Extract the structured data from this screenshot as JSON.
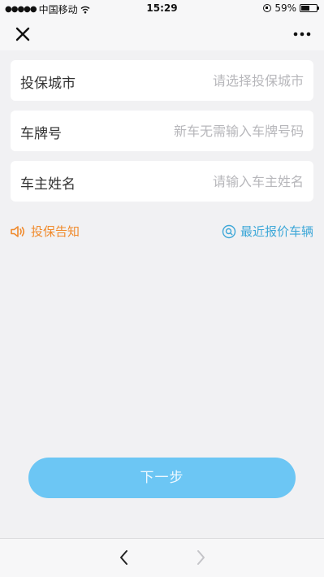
{
  "status_bar": {
    "signal": "●●●●●",
    "carrier": "中国移动",
    "time": "15:29",
    "battery": "59%",
    "battery_level": 0.59
  },
  "form": {
    "fields": [
      {
        "label": "投保城市",
        "placeholder": "请选择投保城市",
        "value": ""
      },
      {
        "label": "车牌号",
        "placeholder": "新车无需输入车牌号码",
        "value": ""
      },
      {
        "label": "车主姓名",
        "placeholder": "请输入车主姓名",
        "value": ""
      }
    ]
  },
  "links": {
    "notice": "投保告知",
    "recent_vehicles": "最近报价车辆"
  },
  "next_button": {
    "label": "下一步"
  },
  "colors": {
    "background": "#f1f1f3",
    "notice_orange": "#f08a2c",
    "link_blue": "#3ea8d8",
    "button_blue": "#6cc6f4"
  },
  "icons": {
    "close": "close-icon",
    "more": "more-icon",
    "notice": "speaker-icon",
    "recent": "search-circle-icon",
    "back": "chevron-left-icon",
    "forward": "chevron-right-icon"
  }
}
